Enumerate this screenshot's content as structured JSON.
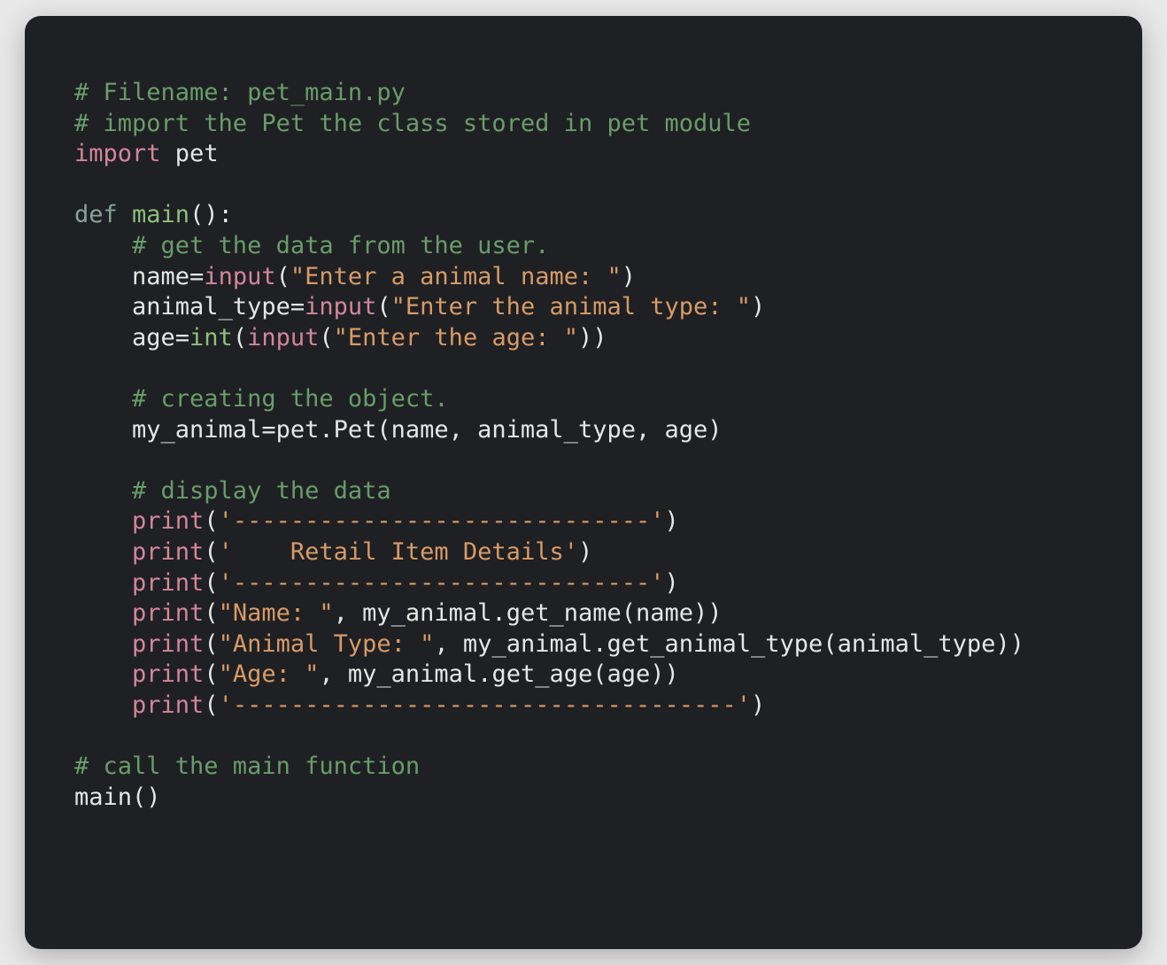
{
  "code": {
    "l01_comment": "# Filename: pet_main.py",
    "l02_comment": "# import the Pet the class stored in pet module",
    "l03_kw": "import",
    "l03_mod": " pet",
    "l05_kw": "def",
    "l05_fn": " main",
    "l05_rest": "():",
    "l06_comment": "    # get the data from the user.",
    "l07_a": "    name=",
    "l07_fn": "input",
    "l07_p1": "(",
    "l07_str": "\"Enter a animal name: \"",
    "l07_p2": ")",
    "l08_a": "    animal_type=",
    "l08_fn": "input",
    "l08_p1": "(",
    "l08_str": "\"Enter the animal type: \"",
    "l08_p2": ")",
    "l09_a": "    age=",
    "l09_int": "int",
    "l09_p1": "(",
    "l09_fn": "input",
    "l09_p2": "(",
    "l09_str": "\"Enter the age: \"",
    "l09_p3": "))",
    "l11_comment": "    # creating the object.",
    "l12_a": "    my_animal=pet.Pet(name, animal_type, age)",
    "l14_comment": "    # display the data",
    "l15_a": "    ",
    "l15_fn": "print",
    "l15_p1": "(",
    "l15_str": "'-----------------------------'",
    "l15_p2": ")",
    "l16_a": "    ",
    "l16_fn": "print",
    "l16_p1": "(",
    "l16_str": "'    Retail Item Details'",
    "l16_p2": ")",
    "l17_a": "    ",
    "l17_fn": "print",
    "l17_p1": "(",
    "l17_str": "'-----------------------------'",
    "l17_p2": ")",
    "l18_a": "    ",
    "l18_fn": "print",
    "l18_p1": "(",
    "l18_str": "\"Name: \"",
    "l18_b": ", my_animal.get_name(name))",
    "l19_a": "    ",
    "l19_fn": "print",
    "l19_p1": "(",
    "l19_str": "\"Animal Type: \"",
    "l19_b": ", my_animal.get_animal_type(animal_type))",
    "l20_a": "    ",
    "l20_fn": "print",
    "l20_p1": "(",
    "l20_str": "\"Age: \"",
    "l20_b": ", my_animal.get_age(age))",
    "l21_a": "    ",
    "l21_fn": "print",
    "l21_p1": "(",
    "l21_str": "'-----------------------------------'",
    "l21_p2": ")",
    "l23_comment": "# call the main function",
    "l24_a": "main()"
  }
}
